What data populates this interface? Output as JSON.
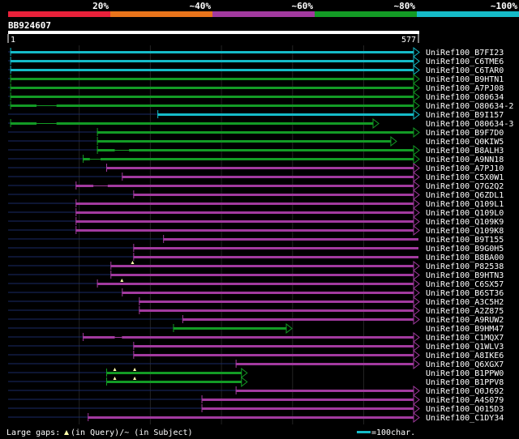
{
  "legend": {
    "labels": [
      "20%",
      "~40%",
      "~60%",
      "~80%",
      "~100%"
    ],
    "colors": [
      "#e8213a",
      "#e8741b",
      "#a23a9f",
      "#139b25",
      "#15bbc8"
    ]
  },
  "query": {
    "id": "BB924607",
    "start_label": "1",
    "end_label": "577"
  },
  "colors": {
    "cyan": "#15bbc8",
    "green": "#139b25",
    "magenta": "#a23a9f",
    "query_line": "#1a2a66",
    "grid": "#232323"
  },
  "hits": [
    {
      "label": "UniRef100_B7FI23",
      "color": "cyan",
      "start": 3,
      "end": 577,
      "arrow": true
    },
    {
      "label": "UniRef100_C6TME6",
      "color": "cyan",
      "start": 3,
      "end": 577,
      "arrow": true
    },
    {
      "label": "UniRef100_C6TAR0",
      "color": "cyan",
      "start": 3,
      "end": 577,
      "arrow": true
    },
    {
      "label": "UniRef100_B9HTN1",
      "color": "green",
      "start": 3,
      "end": 577,
      "arrow": true
    },
    {
      "label": "UniRef100_A7PJ08",
      "color": "green",
      "start": 3,
      "end": 577,
      "arrow": true
    },
    {
      "label": "UniRef100_O80634",
      "color": "green",
      "start": 3,
      "end": 577,
      "arrow": true
    },
    {
      "label": "UniRef100_O80634-2",
      "color": "green",
      "start": 3,
      "end": 577,
      "arrow": true,
      "gaps": [
        [
          40,
          68
        ]
      ]
    },
    {
      "label": "UniRef100_B9I157",
      "color": "cyan",
      "start": 210,
      "end": 577,
      "arrow": true
    },
    {
      "label": "UniRef100_O80634-3",
      "color": "green",
      "start": 3,
      "end": 520,
      "arrow": true,
      "gaps": [
        [
          40,
          68
        ]
      ]
    },
    {
      "label": "UniRef100_B9F7D0",
      "color": "green",
      "start": 125,
      "end": 577,
      "arrow": true
    },
    {
      "label": "UniRef100_Q0KIW5",
      "color": "green",
      "start": 125,
      "end": 545,
      "arrow": true
    },
    {
      "label": "UniRef100_B8ALH3",
      "color": "green",
      "start": 125,
      "end": 577,
      "arrow": true,
      "gaps": [
        [
          150,
          170
        ]
      ]
    },
    {
      "label": "UniRef100_A9NN18",
      "color": "green",
      "start": 105,
      "end": 577,
      "arrow": true,
      "gaps": [
        [
          115,
          130
        ]
      ]
    },
    {
      "label": "UniRef100_A7PJ10",
      "color": "magenta",
      "start": 138,
      "end": 577,
      "arrow": true
    },
    {
      "label": "UniRef100_C5X0W1",
      "color": "magenta",
      "start": 160,
      "end": 577,
      "arrow": true
    },
    {
      "label": "UniRef100_Q7G2Q2",
      "color": "magenta",
      "start": 95,
      "end": 577,
      "arrow": true,
      "gaps": [
        [
          120,
          140
        ]
      ]
    },
    {
      "label": "UniRef100_Q6ZDL1",
      "color": "magenta",
      "start": 176,
      "end": 577,
      "arrow": true
    },
    {
      "label": "UniRef100_Q109L1",
      "color": "magenta",
      "start": 95,
      "end": 577,
      "arrow": true
    },
    {
      "label": "UniRef100_Q109L0",
      "color": "magenta",
      "start": 95,
      "end": 577,
      "arrow": true
    },
    {
      "label": "UniRef100_Q109K9",
      "color": "magenta",
      "start": 95,
      "end": 577,
      "arrow": true
    },
    {
      "label": "UniRef100_Q109K8",
      "color": "magenta",
      "start": 95,
      "end": 577,
      "arrow": true
    },
    {
      "label": "UniRef100_B9T155",
      "color": "magenta",
      "start": 218,
      "end": 577,
      "arrow": false
    },
    {
      "label": "UniRef100_B9G0H5",
      "color": "magenta",
      "start": 176,
      "end": 577,
      "arrow": false
    },
    {
      "label": "UniRef100_B8BA00",
      "color": "magenta",
      "start": 176,
      "end": 577,
      "arrow": false
    },
    {
      "label": "UniRef100_P82538",
      "color": "magenta",
      "start": 144,
      "end": 577,
      "arrow": true,
      "markers": [
        175
      ]
    },
    {
      "label": "UniRef100_B9HTN3",
      "color": "magenta",
      "start": 144,
      "end": 577,
      "arrow": true
    },
    {
      "label": "UniRef100_C6SX57",
      "color": "magenta",
      "start": 125,
      "end": 577,
      "arrow": true,
      "markers": [
        160
      ]
    },
    {
      "label": "UniRef100_B6ST36",
      "color": "magenta",
      "start": 160,
      "end": 577,
      "arrow": true
    },
    {
      "label": "UniRef100_A3C5H2",
      "color": "magenta",
      "start": 184,
      "end": 577,
      "arrow": true
    },
    {
      "label": "UniRef100_A2Z875",
      "color": "magenta",
      "start": 184,
      "end": 577,
      "arrow": true
    },
    {
      "label": "UniRef100_A9RUW2",
      "color": "magenta",
      "start": 245,
      "end": 577,
      "arrow": true
    },
    {
      "label": "UniRef100_B9HM47",
      "color": "green",
      "start": 232,
      "end": 398,
      "arrow": true
    },
    {
      "label": "UniRef100_C1MQX7",
      "color": "magenta",
      "start": 105,
      "end": 577,
      "arrow": true,
      "gaps": [
        [
          150,
          160
        ]
      ]
    },
    {
      "label": "UniRef100_Q1WLV3",
      "color": "magenta",
      "start": 176,
      "end": 577,
      "arrow": true
    },
    {
      "label": "UniRef100_A8IKE6",
      "color": "magenta",
      "start": 176,
      "end": 577,
      "arrow": true
    },
    {
      "label": "UniRef100_Q6XGX7",
      "color": "magenta",
      "start": 320,
      "end": 577,
      "arrow": true
    },
    {
      "label": "UniRef100_B1PPW0",
      "color": "green",
      "start": 138,
      "end": 335,
      "arrow": true,
      "markers": [
        150,
        178
      ]
    },
    {
      "label": "UniRef100_B1PPV8",
      "color": "green",
      "start": 138,
      "end": 335,
      "arrow": true,
      "markers": [
        150,
        178
      ]
    },
    {
      "label": "UniRef100_Q0J692",
      "color": "magenta",
      "start": 320,
      "end": 577,
      "arrow": true
    },
    {
      "label": "UniRef100_A4S079",
      "color": "magenta",
      "start": 272,
      "end": 577,
      "arrow": true
    },
    {
      "label": "UniRef100_Q015D3",
      "color": "magenta",
      "start": 272,
      "end": 577,
      "arrow": true
    },
    {
      "label": "UniRef100_C1DY34",
      "color": "magenta",
      "start": 112,
      "end": 577,
      "arrow": true
    }
  ],
  "footer": {
    "gap_text_1": "Large gaps: ",
    "gap_text_2": "(in Query)/",
    "gap_dash": "~",
    "gap_text_3": " (in Subject)",
    "scale_text": "=100char."
  }
}
